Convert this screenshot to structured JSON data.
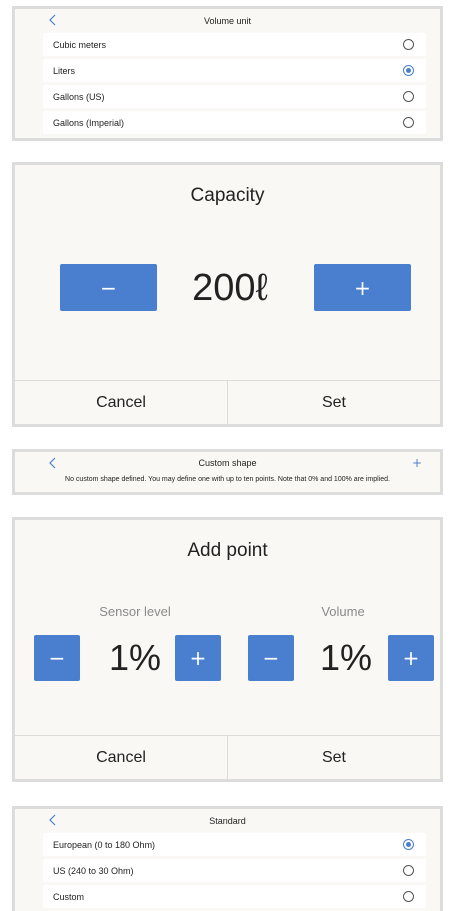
{
  "volume_unit": {
    "title": "Volume unit",
    "options": [
      {
        "label": "Cubic meters",
        "selected": false
      },
      {
        "label": "Liters",
        "selected": true
      },
      {
        "label": "Gallons (US)",
        "selected": false
      },
      {
        "label": "Gallons (Imperial)",
        "selected": false
      }
    ]
  },
  "capacity": {
    "title": "Capacity",
    "value": "200ℓ",
    "minus_label": "−",
    "plus_label": "+",
    "cancel": "Cancel",
    "set": "Set"
  },
  "custom_shape": {
    "title": "Custom shape",
    "add_icon": "+",
    "message": "No custom shape defined. You may define one with up to ten points. Note that 0% and 100% are implied."
  },
  "add_point": {
    "title": "Add point",
    "sensor_label": "Sensor level",
    "sensor_value": "1%",
    "volume_label": "Volume",
    "volume_value": "1%",
    "minus_label": "−",
    "plus_label": "+",
    "cancel": "Cancel",
    "set": "Set"
  },
  "standard": {
    "title": "Standard",
    "options": [
      {
        "label": "European (0 to 180 Ohm)",
        "selected": true
      },
      {
        "label": "US (240 to 30 Ohm)",
        "selected": false
      },
      {
        "label": "Custom",
        "selected": false
      }
    ]
  },
  "colors": {
    "accent": "#4a7fcf",
    "panel_bg": "#f9f8f5",
    "border": "#dcdcdc"
  },
  "icons": {
    "back": "chevron-left-icon",
    "add": "plus-icon",
    "radio_on": "radio-selected-icon",
    "radio_off": "radio-unselected-icon"
  }
}
